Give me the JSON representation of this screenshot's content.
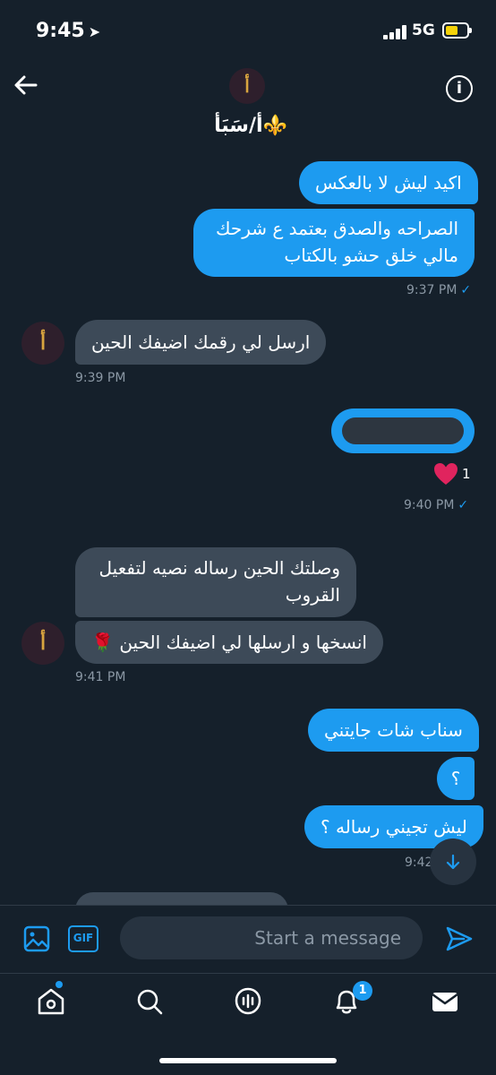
{
  "status": {
    "time": "9:45",
    "location_icon": "➤",
    "network": "5G"
  },
  "header": {
    "name": "أ/سَبَأ",
    "emoji": "⚜️",
    "back_icon": "arrow-left-icon",
    "info_icon": "info-icon"
  },
  "avatar_logo": "أ",
  "messages": {
    "m1": "اكيد ليش لا بالعكس",
    "m2_line1": "الصراحه والصدق بعتمد ع شرحك",
    "m2_line2": "مالي خلق حشو بالكتاب",
    "t1": "9:37 PM",
    "m3": "ارسل لي رقمك اضيفك الحين",
    "t2": "9:39 PM",
    "heart_count": "1",
    "t3": "9:40 PM",
    "m4_line1": "وصلتك الحين رساله نصيه لتفعيل",
    "m4_line2": "القروب",
    "m5": "انسخها و ارسلها لي اضيفك الحين 🌹",
    "t4": "9:41 PM",
    "m6": "سناب شات جايتني",
    "m7": "؟",
    "m8": "ليش تجيني رساله ؟",
    "t5": "9:42"
  },
  "check_mark": "✓",
  "compose": {
    "placeholder": "Start a message",
    "gif_label": "GIF"
  },
  "tabbar": {
    "notifications_badge": "1"
  },
  "colors": {
    "background": "#15202b",
    "outgoing": "#1d9bf0",
    "incoming": "#3d4a58",
    "accent": "#1d9bf0"
  }
}
